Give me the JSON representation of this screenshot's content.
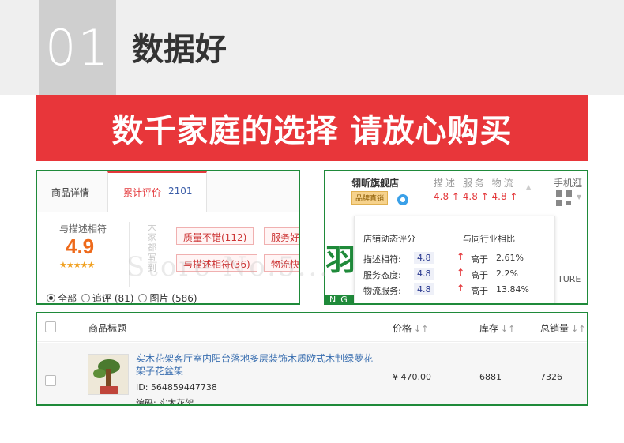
{
  "header": {
    "number": "01",
    "title": "数据好"
  },
  "banner": {
    "text": "数千家庭的选择 请放心购买"
  },
  "review_panel": {
    "tabs": [
      {
        "label": "商品详情"
      },
      {
        "label": "累计评价",
        "count": "2101"
      }
    ],
    "rating_label": "与描述相符",
    "rating_value": "4.9",
    "stars": "★★★★★",
    "impression_label": "大家都写到",
    "tags": [
      "质量不错(112)",
      "服务好",
      "与描述相符(36)",
      "物流快"
    ],
    "filters": [
      {
        "label": "全部",
        "selected": true
      },
      {
        "label": "追评 (81)",
        "selected": false
      },
      {
        "label": "图片 (586)",
        "selected": false
      }
    ]
  },
  "store_panel": {
    "store_name": "翎昕旗舰店",
    "badge": "品牌直销",
    "score_header": "描述 服务 物流",
    "scores": "4.8 ↑ 4.8 ↑ 4.8 ↑",
    "mobile_label": "手机逛",
    "bg_text": "TURE",
    "bg_glyph": "羽",
    "bg_bar": "NG",
    "popup": {
      "col1_title": "店铺动态评分",
      "col2_title": "与同行业相比",
      "rows": [
        {
          "label": "描述相符:",
          "value": "4.8",
          "compare": "高于",
          "percent": "2.61%"
        },
        {
          "label": "服务态度:",
          "value": "4.8",
          "compare": "高于",
          "percent": "2.2%"
        },
        {
          "label": "物流服务:",
          "value": "4.8",
          "compare": "高于",
          "percent": "13.84%"
        }
      ]
    }
  },
  "product_table": {
    "columns": {
      "title": "商品标题",
      "price": "价格",
      "stock": "库存",
      "sales": "总销量"
    },
    "row": {
      "title": "实木花架客厅室内阳台落地多层装饰木质欧式木制绿萝花架子花盆架",
      "id": "ID: 564859447738",
      "code": "编码: 实木花架",
      "price": "¥ 470.00",
      "stock": "6881",
      "sales": "7326"
    }
  },
  "watermark": "Store No.5..."
}
